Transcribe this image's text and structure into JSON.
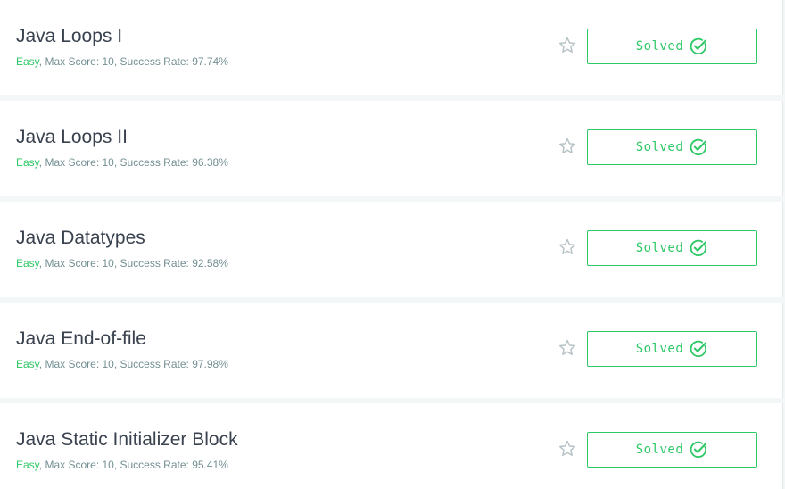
{
  "challenges": [
    {
      "title": "Java Loops I",
      "difficulty": "Easy",
      "meta": ", Max Score: 10, Success Rate: 97.74%",
      "status_label": "Solved"
    },
    {
      "title": "Java Loops II",
      "difficulty": "Easy",
      "meta": ", Max Score: 10, Success Rate: 96.38%",
      "status_label": "Solved"
    },
    {
      "title": "Java Datatypes",
      "difficulty": "Easy",
      "meta": ", Max Score: 10, Success Rate: 92.58%",
      "status_label": "Solved"
    },
    {
      "title": "Java End-of-file",
      "difficulty": "Easy",
      "meta": ", Max Score: 10, Success Rate: 97.98%",
      "status_label": "Solved"
    },
    {
      "title": "Java Static Initializer Block",
      "difficulty": "Easy",
      "meta": ", Max Score: 10, Success Rate: 95.41%",
      "status_label": "Solved"
    }
  ],
  "icons": {
    "bookmark": "star-outline-icon",
    "solved": "check-circle-icon"
  },
  "colors": {
    "accent_green": "#2ec866",
    "title_text": "#39424e",
    "meta_text": "#738f93",
    "star_stroke": "#b7c2c6",
    "background": "#f3f7f7"
  }
}
